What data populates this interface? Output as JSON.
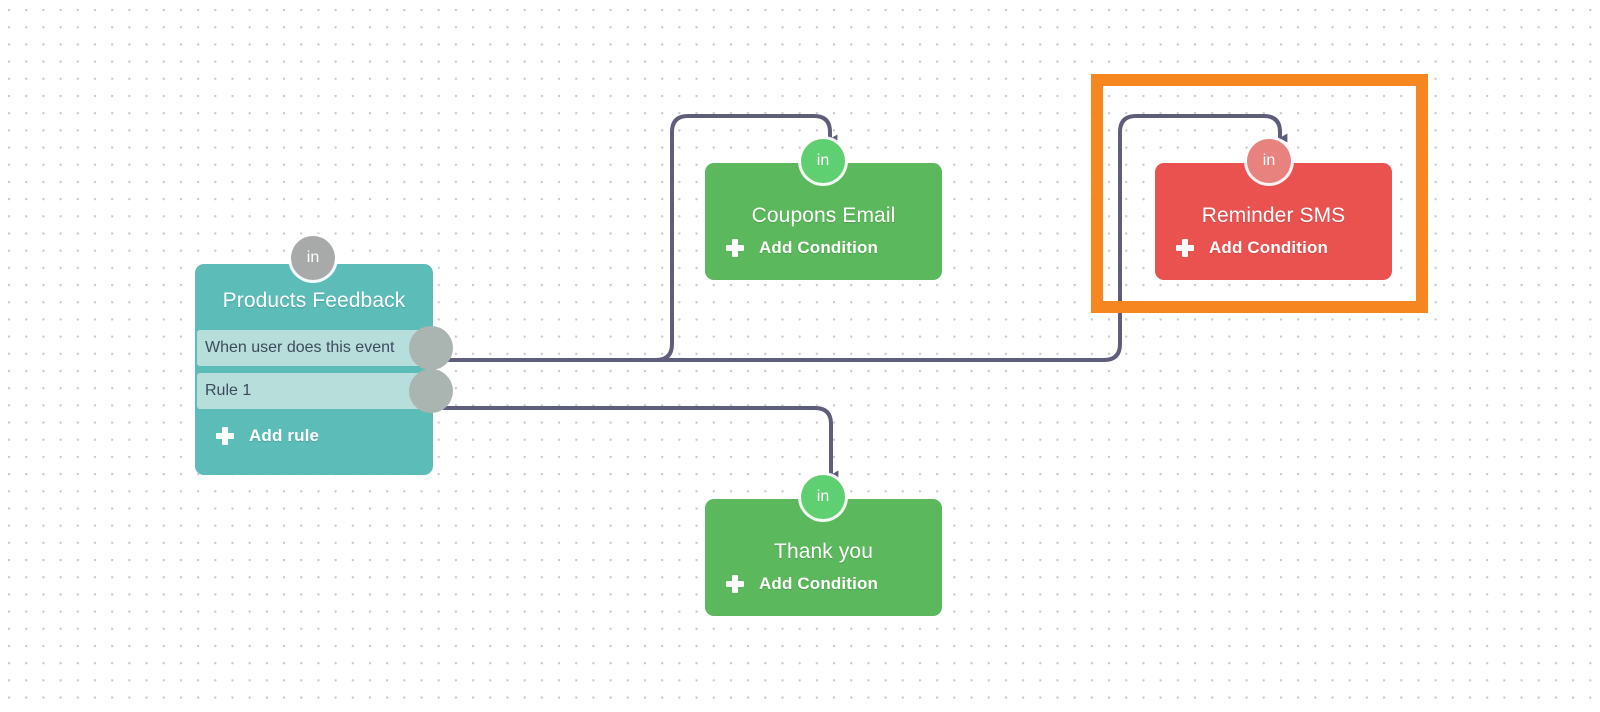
{
  "canvas": {
    "background_color": "#ffffff",
    "grid_dot_color": "#c9c9d0"
  },
  "selection": {
    "color": "#f6861f",
    "selected_node": "Reminder SMS",
    "border_width_px": 12
  },
  "edge_color": "#5f5e7a",
  "nodes": [
    {
      "id": "trigger",
      "title": "Products Feedback",
      "type": "trigger",
      "color": "#5bbcb8",
      "row_color": "#b7dedb",
      "badge_label": "in",
      "badge_color": "#a8aaa9",
      "rows": [
        {
          "label": "When user does this event"
        },
        {
          "label": "Rule 1"
        }
      ],
      "action_label": "Add rule",
      "action_icon": "plus-icon"
    },
    {
      "id": "coupons-email",
      "title": "Coupons Email",
      "type": "step",
      "color": "#5cb85c",
      "badge_label": "in",
      "badge_color": "#5fd072",
      "action_label": "Add Condition",
      "action_icon": "plus-icon"
    },
    {
      "id": "reminder-sms",
      "title": "Reminder SMS",
      "type": "step",
      "color": "#ea5250",
      "badge_label": "in",
      "badge_color": "#e8827f",
      "action_label": "Add Condition",
      "action_icon": "plus-icon",
      "selected": true
    },
    {
      "id": "thank-you",
      "title": "Thank you",
      "type": "step",
      "color": "#5cb85c",
      "badge_label": "in",
      "badge_color": "#5fd072",
      "action_label": "Add Condition",
      "action_icon": "plus-icon"
    }
  ],
  "edges": [
    {
      "from": "trigger.When user does this event",
      "to": "coupons-email.in"
    },
    {
      "from": "trigger.When user does this event",
      "to": "reminder-sms.in"
    },
    {
      "from": "trigger.Rule 1",
      "to": "thank-you.in"
    }
  ]
}
